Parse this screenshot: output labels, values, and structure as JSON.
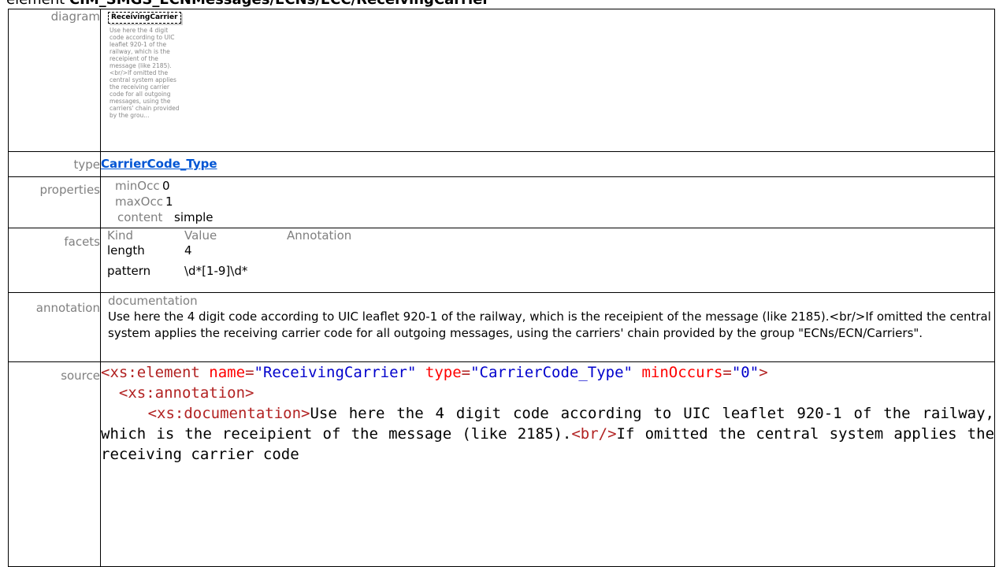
{
  "heading": {
    "prefix": "element ",
    "path": "CIM_SMGS_ECNMessages/ECNs/ECC/ReceivingCarrier"
  },
  "labels": {
    "diagram": "diagram",
    "type": "type",
    "properties": "properties",
    "facets": "facets",
    "annotation": "annotation",
    "source": "source"
  },
  "diagram": {
    "element_name": "ReceivingCarrier",
    "doc_excerpt": "Use here the 4 digit code according to UIC leaflet 920-1 of the railway, which is the receipient of the message (like 2185).<br/>If omitted the central system applies the receiving carrier code for all outgoing messages, using the carriers' chain provided by the grou..."
  },
  "type": {
    "link_text": "CarrierCode_Type"
  },
  "properties": [
    {
      "key": "minOcc",
      "value": "0"
    },
    {
      "key": "maxOcc",
      "value": "1"
    },
    {
      "key": "content",
      "value": "simple"
    }
  ],
  "facets": {
    "headers": [
      "Kind",
      "Value",
      "Annotation"
    ],
    "rows": [
      {
        "kind": "length",
        "value": "4",
        "annotation": ""
      },
      {
        "kind": "pattern",
        "value": "\\d*[1-9]\\d*",
        "annotation": ""
      }
    ]
  },
  "annotation": {
    "heading": "documentation",
    "text": "Use here the 4 digit code according to UIC leaflet 920-1 of the railway, which is the receipient of the message (like 2185).<br/>If omitted the central system applies the receiving carrier code for all outgoing messages, using the carriers' chain provided by the group \"ECNs/ECN/Carriers\"."
  },
  "source": {
    "l1_open": "<xs:element",
    "l1_a1": "name",
    "l1_eq1": "=",
    "l1_v1": "\"ReceivingCarrier\"",
    "l1_a2": "type",
    "l1_eq2": "=",
    "l1_v2": "\"CarrierCode_Type\"",
    "l1_a3": "minOccurs",
    "l1_eq3": "=",
    "l1_v3": "\"0\"",
    "l1_close": ">",
    "l2": "<xs:annotation>",
    "l3_tag": "<xs:documentation>",
    "l3_text": "Use here the 4 digit code according to UIC leaflet 920-1 of the railway, which is the receipient of the message (like 2185).",
    "l3_br": "<br/>",
    "l3_text2": "If omitted the central system applies the receiving carrier code"
  }
}
